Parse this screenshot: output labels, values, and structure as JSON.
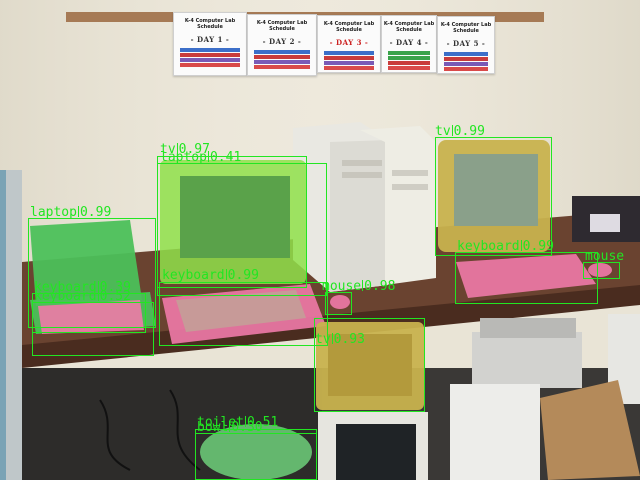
{
  "schedule_sheets": [
    {
      "title": "K-4 Computer Lab Schedule",
      "day": "- DAY 1 -"
    },
    {
      "title": "K-4 Computer Lab Schedule",
      "day": "- DAY 2 -"
    },
    {
      "title": "K-4 Computer Lab Schedule",
      "day": "- DAY 3 -"
    },
    {
      "title": "K-4 Computer Lab Schedule",
      "day": "- DAY 4 -"
    },
    {
      "title": "K-4 Computer Lab Schedule",
      "day": "- DAY 5 -"
    }
  ],
  "detections": [
    {
      "label": "tv",
      "score": "0.97"
    },
    {
      "label": "laptop",
      "score": "0.41"
    },
    {
      "label": "tv",
      "score": "0.99"
    },
    {
      "label": "laptop",
      "score": "0.99"
    },
    {
      "label": "keyboard",
      "score": "0.39"
    },
    {
      "label": "keyboard",
      "score": "0.52"
    },
    {
      "label": "keyboard",
      "score": "0.99"
    },
    {
      "label": "mouse",
      "score": "0.98"
    },
    {
      "label": "keyboard",
      "score": "0.99"
    },
    {
      "label": "mouse",
      "score": ""
    },
    {
      "label": "tv",
      "score": "0.93"
    },
    {
      "label": "toilet",
      "score": "0.51"
    },
    {
      "label": "bowl",
      "score": "0.30"
    }
  ],
  "colors": {
    "box": "#22e622",
    "tv_mask": "#8fe04a",
    "keyboard_mask": "#f07aa8",
    "laptop_mask": "#4cc05a",
    "crt_mask": "#c8b24e"
  }
}
